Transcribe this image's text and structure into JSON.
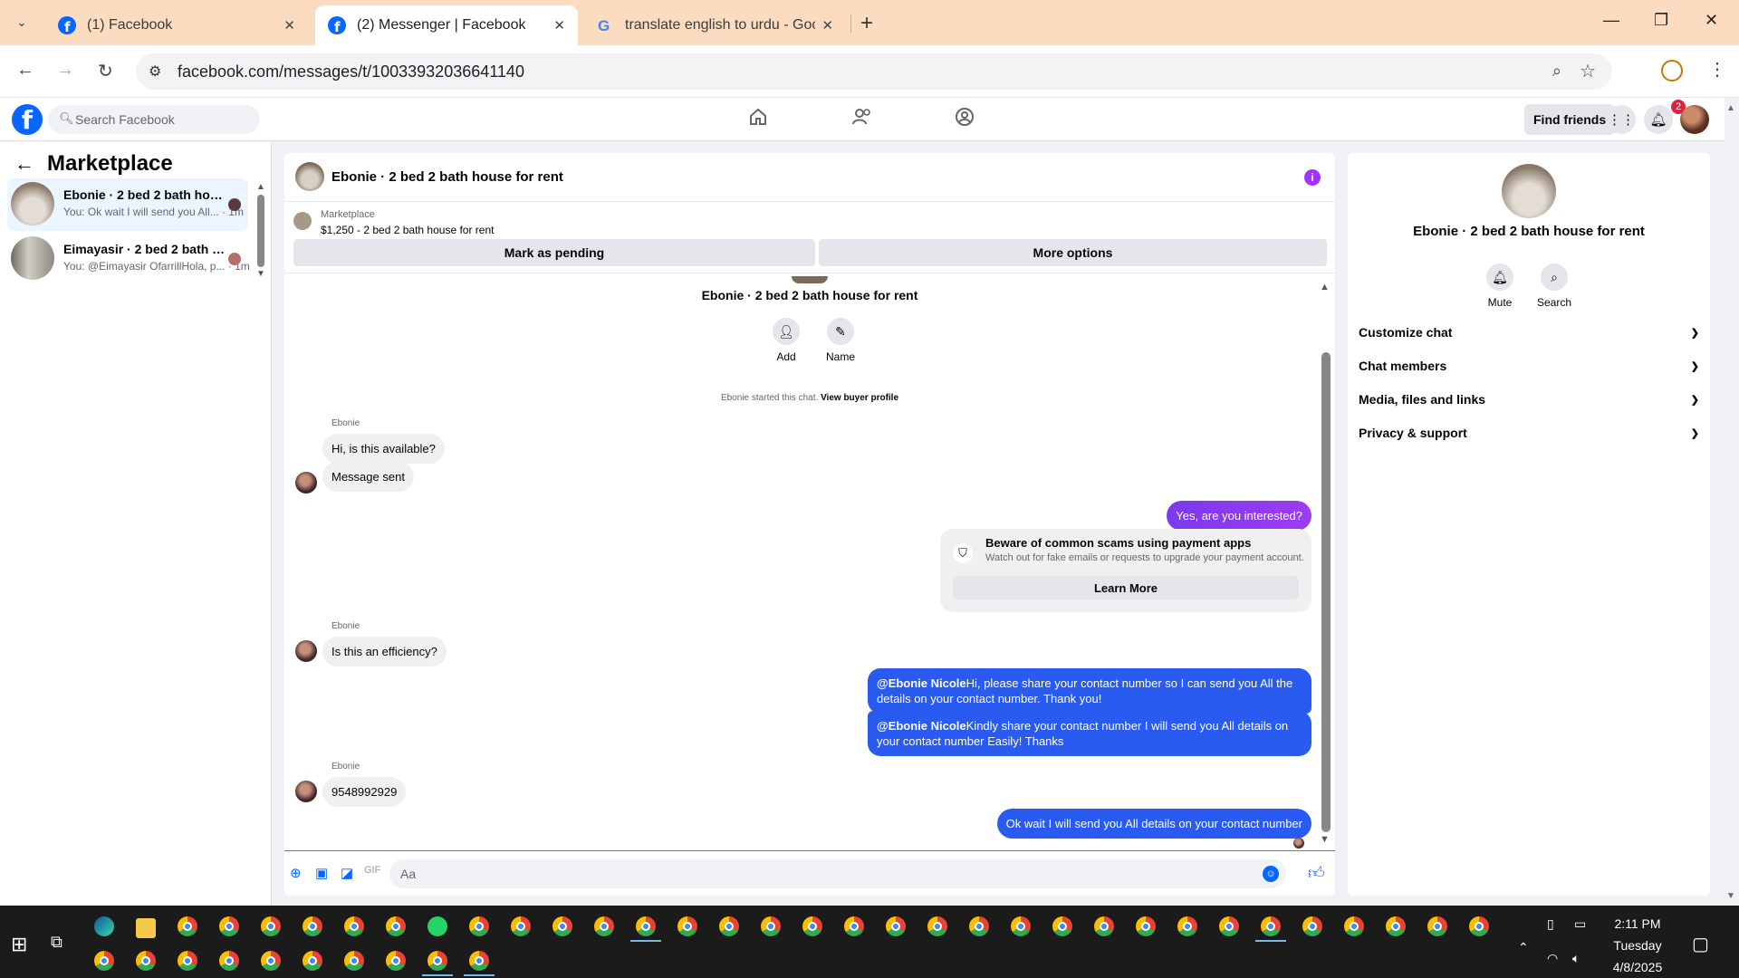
{
  "browser": {
    "tabs": [
      {
        "title": "(1) Facebook",
        "favicon": "facebook-icon"
      },
      {
        "title": "(2) Messenger | Facebook",
        "favicon": "facebook-icon"
      },
      {
        "title": "translate english to urdu - Goo",
        "favicon": "google-icon"
      }
    ],
    "url": "facebook.com/messages/t/10033932036641140"
  },
  "fb": {
    "search_placeholder": "Search Facebook",
    "find_friends": "Find friends",
    "notif_count": "2"
  },
  "sidebar": {
    "title": "Marketplace",
    "conversations": [
      {
        "name": "Ebonie · 2 bed 2 bath house ...",
        "snippet": "You: Ok wait I will send you All... · 1m"
      },
      {
        "name": "Eimayasir · 2 bed 2 bath hou...",
        "snippet": "You: @Eimayasir OfarrillHola, p... · 1m"
      }
    ]
  },
  "chat": {
    "title": "Ebonie · 2 bed 2 bath house for rent",
    "marketplace_label": "Marketplace",
    "listing": "$1,250 - 2 bed 2 bath house for rent",
    "mark_pending": "Mark as pending",
    "more_options": "More options",
    "intro_name": "Ebonie · 2 bed 2 bath house for rent",
    "add_label": "Add",
    "name_label": "Name",
    "started_text": "Ebonie started this chat.",
    "view_profile": "View buyer profile",
    "sender": "Ebonie",
    "msgs": {
      "m1": "Hi, is this available?",
      "m2": "Message sent",
      "m3": "Yes, are you interested?",
      "m4": "Is this an efficiency?",
      "m5_mention": "@Ebonie Nicole",
      "m5_text": "Hi, please share your contact number so I can send you All the details on your contact number. Thank you!",
      "m6_mention": "@Ebonie Nicole",
      "m6_text": "Kindly share your contact number I will send you All details on your contact number Easily! Thanks",
      "m7": "9548992929",
      "m8": "Ok wait I will send you All details on your contact number"
    },
    "scam": {
      "title": "Beware of common scams using payment apps",
      "body": "Watch out for fake emails or requests to upgrade your payment account.",
      "button": "Learn More"
    },
    "composer_placeholder": "Aa"
  },
  "details": {
    "name": "Ebonie · 2 bed 2 bath house for rent",
    "mute": "Mute",
    "search": "Search",
    "sections": [
      "Customize chat",
      "Chat members",
      "Media, files and links",
      "Privacy & support"
    ]
  },
  "taskbar": {
    "time": "2:11 PM",
    "day": "Tuesday",
    "date": "4/8/2025"
  },
  "colors": {
    "fb_blue": "#0866ff",
    "outgoing_blue": "#2a5bf0",
    "outgoing_purple": "#9333ea",
    "tabbar": "#fcdcc0"
  }
}
